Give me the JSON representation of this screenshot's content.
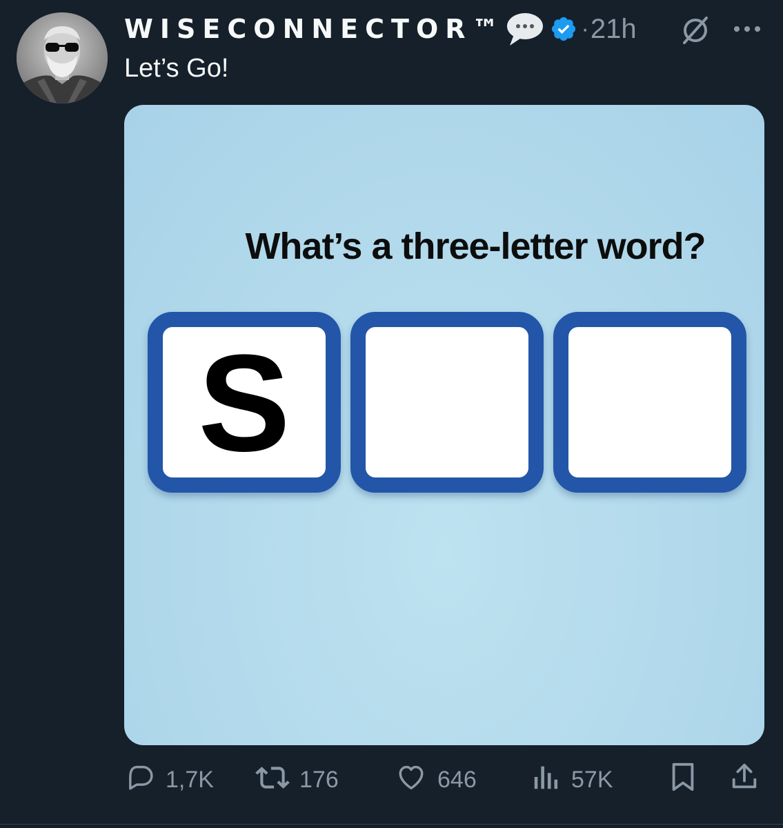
{
  "post": {
    "author": {
      "display_name": "WISECONNECTOR™",
      "avatar_icon": "profile-photo",
      "badges": [
        "speech-bubble-icon",
        "verified-icon"
      ],
      "verified_color": "#1d9bf0"
    },
    "separator": "·",
    "timestamp": "21h",
    "text": "Let’s Go!",
    "menu_icons": [
      "grok-icon",
      "more-icon"
    ]
  },
  "media": {
    "question": "What’s a three-letter word?",
    "tiles": [
      "S",
      "",
      ""
    ],
    "tile_border_color": "#2356a8",
    "background_color": "#b4dbec"
  },
  "actions": {
    "reply": {
      "icon": "reply-icon",
      "count": "1,7K"
    },
    "repost": {
      "icon": "repost-icon",
      "count": "176"
    },
    "like": {
      "icon": "heart-icon",
      "count": "646"
    },
    "views": {
      "icon": "views-icon",
      "count": "57K"
    },
    "bookmark": {
      "icon": "bookmark-icon"
    },
    "share": {
      "icon": "share-icon"
    }
  },
  "theme": {
    "background": "#15202b",
    "primary_text": "#f7f9f9",
    "secondary_text": "#8b98a5"
  }
}
